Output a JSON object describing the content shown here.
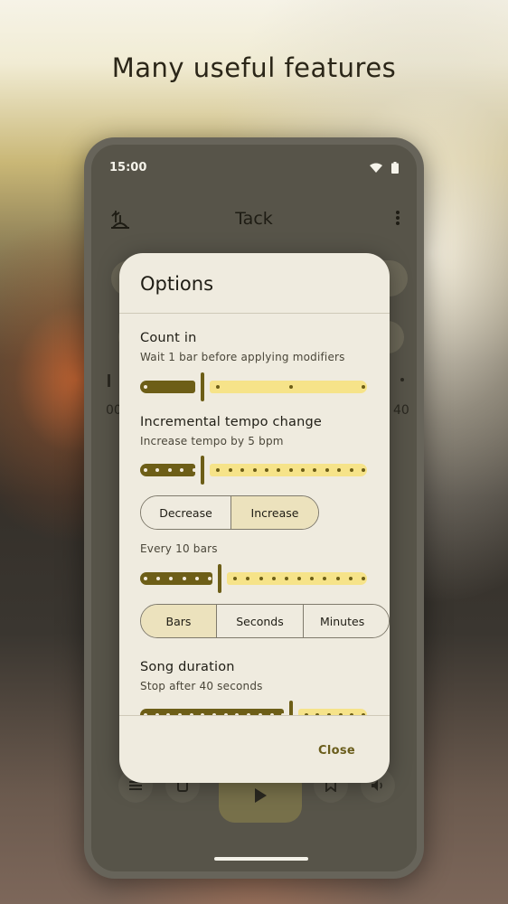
{
  "headline": "Many useful features",
  "status": {
    "time": "15:00",
    "wifi_icon": "wifi-icon",
    "battery_icon": "battery-icon"
  },
  "app": {
    "title": "Tack",
    "logo_icon": "tack-logo-icon",
    "menu_icon": "more-vert-icon"
  },
  "background_fragments": {
    "left_value": "00",
    "right_value": "40"
  },
  "dialog": {
    "title": "Options",
    "count_in": {
      "title": "Count in",
      "subtitle": "Wait 1 bar before applying modifiers",
      "slider_value": 1,
      "slider_max": 4
    },
    "incremental": {
      "title": "Incremental tempo change",
      "subtitle": "Increase tempo by 5 bpm",
      "slider_value": 5,
      "slider_max": 20,
      "direction_options": [
        "Decrease",
        "Increase"
      ],
      "direction_selected": "Increase",
      "every_label": "Every 10 bars",
      "every_value": 10,
      "every_max": 30,
      "unit_options": [
        "Bars",
        "Seconds",
        "Minutes"
      ],
      "unit_selected": "Bars"
    },
    "song_duration": {
      "title": "Song duration",
      "subtitle": "Stop after 40 seconds",
      "slider_value": 40,
      "slider_max": 60
    },
    "close_label": "Close"
  },
  "colors": {
    "accent_dark": "#6d5e17",
    "accent_light": "#f6e389",
    "dialog_bg": "#efebdf",
    "selected_segment": "#ece2bd"
  }
}
